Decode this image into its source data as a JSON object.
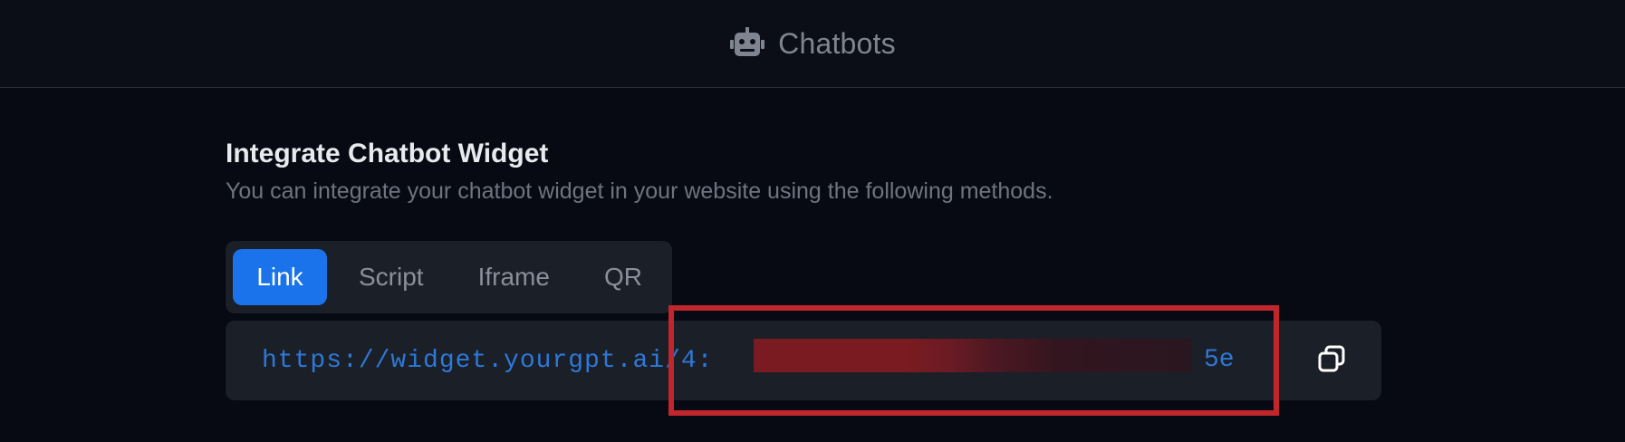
{
  "header": {
    "title": "Chatbots",
    "icon": "robot-icon"
  },
  "main": {
    "heading": "Integrate Chatbot Widget",
    "subtitle": "You can integrate your chatbot widget in your website using the following methods."
  },
  "tabs": [
    {
      "label": "Link",
      "active": true
    },
    {
      "label": "Script",
      "active": false
    },
    {
      "label": "Iframe",
      "active": false
    },
    {
      "label": "QR",
      "active": false
    }
  ],
  "link": {
    "visible_start": "https://widget.yourgpt.ai/4:",
    "visible_end": "5e",
    "copy_icon": "copy-icon"
  },
  "colors": {
    "background": "#070a12",
    "accent": "#1a73ea",
    "link": "#2e78d8",
    "highlight": "#c0262c"
  }
}
